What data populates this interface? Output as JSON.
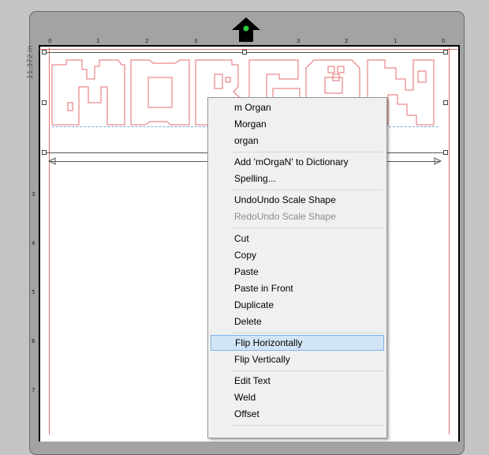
{
  "ruler": {
    "top_ticks": [
      "0",
      "1",
      "2",
      "3",
      "4",
      "3",
      "2",
      "1",
      "0"
    ],
    "left_ticks": [
      "3",
      "4",
      "5",
      "6",
      "7"
    ],
    "dimension_text": "11.372 in"
  },
  "colors": {
    "accent": "#7eb4ea",
    "cut_line": "#e07070",
    "menu_bg": "#f0f0f0",
    "hover_bg": "#d2e5f6",
    "origin_dot": "#2ecc40"
  },
  "design_text": "mOrgaN",
  "context_menu": {
    "groups": [
      [
        {
          "label": "m Organ",
          "enabled": true
        },
        {
          "label": "Morgan",
          "enabled": true
        },
        {
          "label": "organ",
          "enabled": true
        }
      ],
      [
        {
          "label": "Add 'mOrgaN' to Dictionary",
          "enabled": true
        },
        {
          "label": "Spelling...",
          "enabled": true
        }
      ],
      [
        {
          "label": "UndoUndo Scale Shape",
          "enabled": true
        },
        {
          "label": "RedoUndo Scale Shape",
          "enabled": false
        }
      ],
      [
        {
          "label": "Cut",
          "enabled": true
        },
        {
          "label": "Copy",
          "enabled": true
        },
        {
          "label": "Paste",
          "enabled": true
        },
        {
          "label": "Paste in Front",
          "enabled": true
        },
        {
          "label": "Duplicate",
          "enabled": true
        },
        {
          "label": "Delete",
          "enabled": true
        }
      ],
      [
        {
          "label": "Flip Horizontally",
          "enabled": true,
          "highlighted": true
        },
        {
          "label": "Flip Vertically",
          "enabled": true
        }
      ],
      [
        {
          "label": "Edit Text",
          "enabled": true
        },
        {
          "label": "Weld",
          "enabled": true
        },
        {
          "label": "Offset",
          "enabled": true
        }
      ]
    ]
  }
}
